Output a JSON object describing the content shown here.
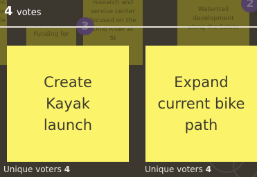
{
  "header": {
    "count": "4",
    "label": "votes"
  },
  "background_cards": [
    {
      "text": "ent\nike\nle"
    },
    {
      "text": "Funding for"
    },
    {
      "text": "research and\nservice center\nfocused on the\nOhio River at\nSt"
    },
    {
      "text": "Watertrail\ndevelopment\nalong the Scioto"
    }
  ],
  "background_badges": [
    "3",
    "2"
  ],
  "cards": [
    {
      "text": "Create\nKayak\nlaunch",
      "voters_label": "Unique voters",
      "voters_count": "4"
    },
    {
      "text": "Expand\ncurrent bike\npath",
      "voters_label": "Unique voters",
      "voters_count": "4"
    }
  ],
  "colors": {
    "card": "#fbf46b",
    "background_card": "#b8ae2f",
    "badge": "#7d5aa8",
    "overlay": "#4f4a3e"
  }
}
